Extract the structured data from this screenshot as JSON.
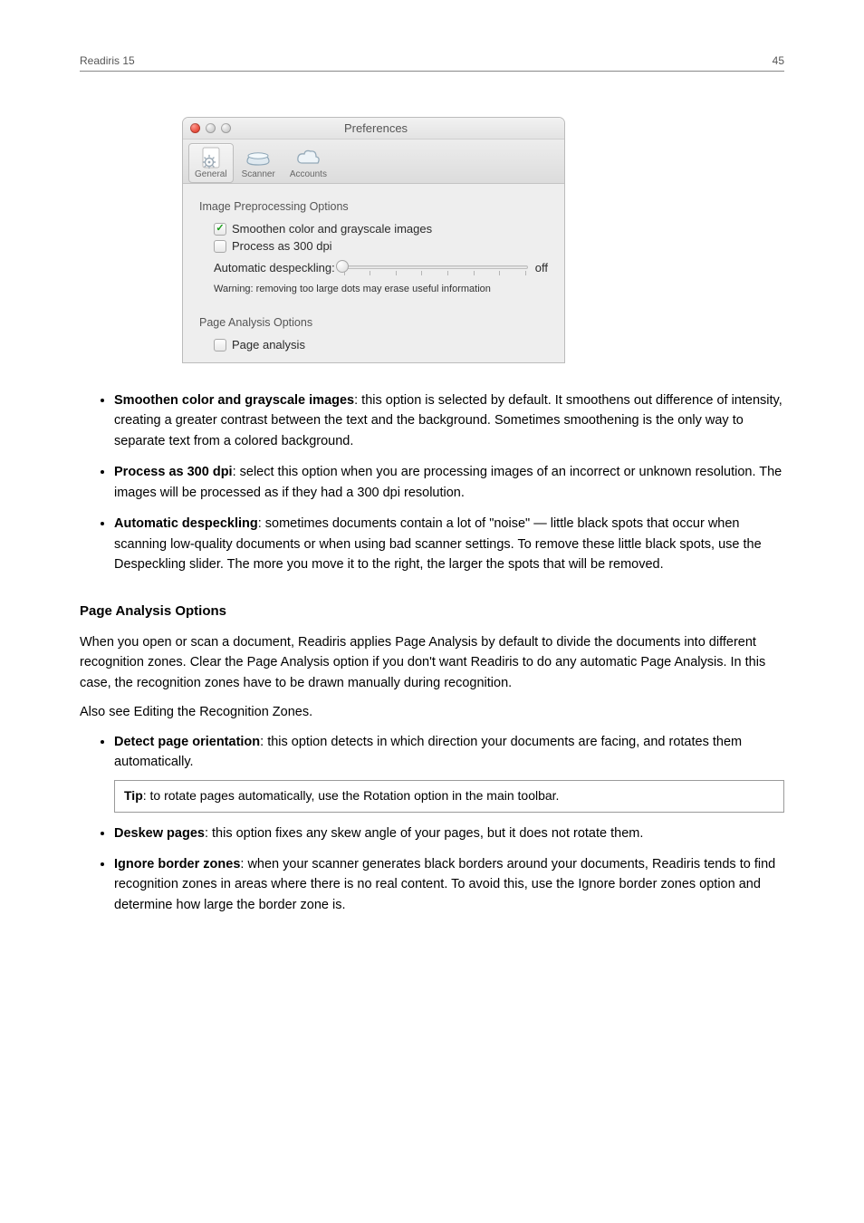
{
  "page_header": {
    "left": "Readiris 15",
    "right": "45"
  },
  "prefs": {
    "window_title": "Preferences",
    "tabs": {
      "general": "General",
      "scanner": "Scanner",
      "accounts": "Accounts"
    },
    "section_image": "Image Preprocessing Options",
    "opt_smoothen": "Smoothen color and grayscale images",
    "opt_300dpi": "Process as 300 dpi",
    "opt_despeckle_label": "Automatic despeckling:",
    "slider_value_label": "off",
    "warn": "Warning: removing too large dots may erase useful information",
    "section_page": "Page Analysis Options",
    "opt_page_analysis": "Page analysis"
  },
  "bullets_top": [
    {
      "title": "Smoothen color and grayscale images",
      "text": ": this option is selected by default. It smoothens out difference of intensity, creating a greater contrast between the text and the background. Sometimes smoothening is the only way to separate text from a colored background."
    },
    {
      "title": "Process as 300 dpi",
      "text": ": select this option when you are processing images of an incorrect or unknown resolution. The images will be processed as if they had a 300 dpi resolution."
    },
    {
      "title": "Automatic despeckling",
      "text": ": sometimes documents contain a lot of \"noise\" — little black spots that occur when scanning low-quality documents or when using bad scanner settings. To remove these little black spots, use the Despeckling slider. The more you move it to the right, the larger the spots that will be removed."
    }
  ],
  "subsection": {
    "title": "Page Analysis Options",
    "intro": "When you open or scan a document, Readiris applies Page Analysis by default to divide the documents into different recognition zones. Clear the Page Analysis option if you don't want Readiris to do any automatic Page Analysis. In this case, the recognition zones have to be drawn manually during recognition.",
    "see_also": "Also see Editing the Recognition Zones."
  },
  "bullets_bottom": {
    "b1_title": "Detect page orientation",
    "b1_text": ": this option detects in which direction your documents are facing, and rotates them automatically.",
    "tip_label": "Tip",
    "tip_text": ": to rotate pages automatically, use the Rotation option in the main toolbar.",
    "b2_title": "Deskew pages",
    "b2_text": ": this option fixes any skew angle of your pages, but it does not rotate them.",
    "b3_title": "Ignore border zones",
    "b3_text": ": when your scanner generates black borders around your documents, Readiris tends to find recognition zones in areas where there is no real content. To avoid this, use the Ignore border zones option and determine how large the border zone is."
  }
}
